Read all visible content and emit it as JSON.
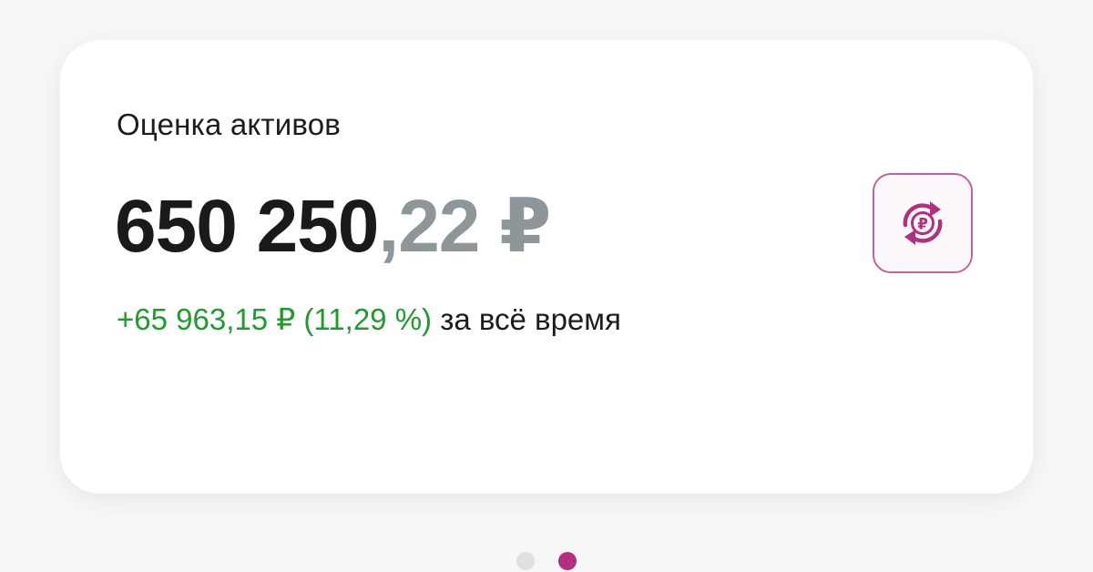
{
  "portfolio": {
    "title": "Оценка активов",
    "value_integer": "650 250",
    "value_fraction": ",22 ₽",
    "change_value": "+65 963,15 ₽ (11,29 %)",
    "change_period": " за всё время"
  },
  "action": {
    "icon": "ruble-exchange-icon",
    "icon_glyph": "₽"
  },
  "pagination": {
    "total": 2,
    "active_index": 1
  },
  "colors": {
    "positive": "#1f9b2f",
    "muted": "#8e9699",
    "accent": "#b3307f",
    "dot_inactive": "#e0e0e0"
  }
}
